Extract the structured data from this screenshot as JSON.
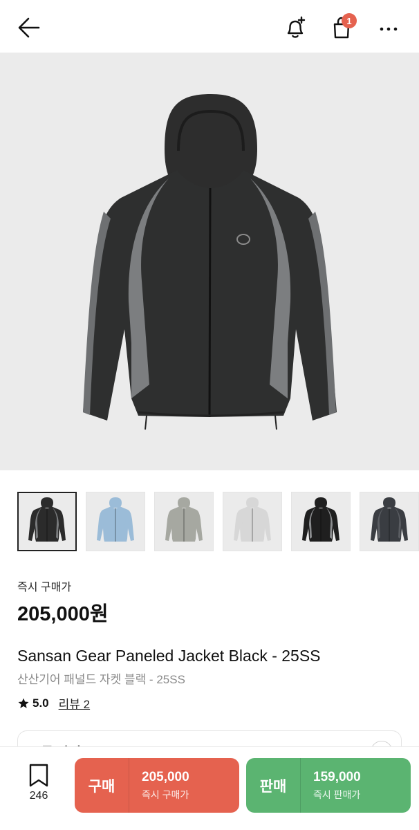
{
  "header": {
    "back_icon": "arrow-left-icon",
    "bell_icon": "bell-plus-icon",
    "cart_icon": "shopping-bag-icon",
    "cart_badge": "1",
    "more_icon": "more-horizontal-icon"
  },
  "product": {
    "instant_buy_label": "즉시 구매가",
    "price": "205,000원",
    "title_en": "Sansan Gear Paneled Jacket Black - 25SS",
    "title_ko": "산산기어 패널드 자켓 블랙 - 25SS",
    "rating": "5.0",
    "review_link": "리뷰 2"
  },
  "thumbnails": [
    {
      "color": "black-grey",
      "body": "#2b2b2b",
      "panel": "#7a7c7e",
      "selected": true
    },
    {
      "color": "light-blue",
      "body": "#9bbcd8",
      "panel": "#9bbcd8"
    },
    {
      "color": "khaki-grey",
      "body": "#a6a8a1",
      "panel": "#a6a8a1"
    },
    {
      "color": "light-grey",
      "body": "#d7d7d7",
      "panel": "#d7d7d7"
    },
    {
      "color": "black-contrast",
      "body": "#1f1f1f",
      "panel": "#8a8c8e"
    },
    {
      "color": "charcoal",
      "body": "#3a3d42",
      "panel": "#5a5d62"
    }
  ],
  "size_section": {
    "label": "모든 사이즈"
  },
  "bottom_bar": {
    "wish_count": "246",
    "buy": {
      "label": "구매",
      "amount": "205,000",
      "sub": "즉시 구매가",
      "color": "#e5624f"
    },
    "sell": {
      "label": "판매",
      "amount": "159,000",
      "sub": "즉시 판매가",
      "color": "#5bb471"
    }
  }
}
